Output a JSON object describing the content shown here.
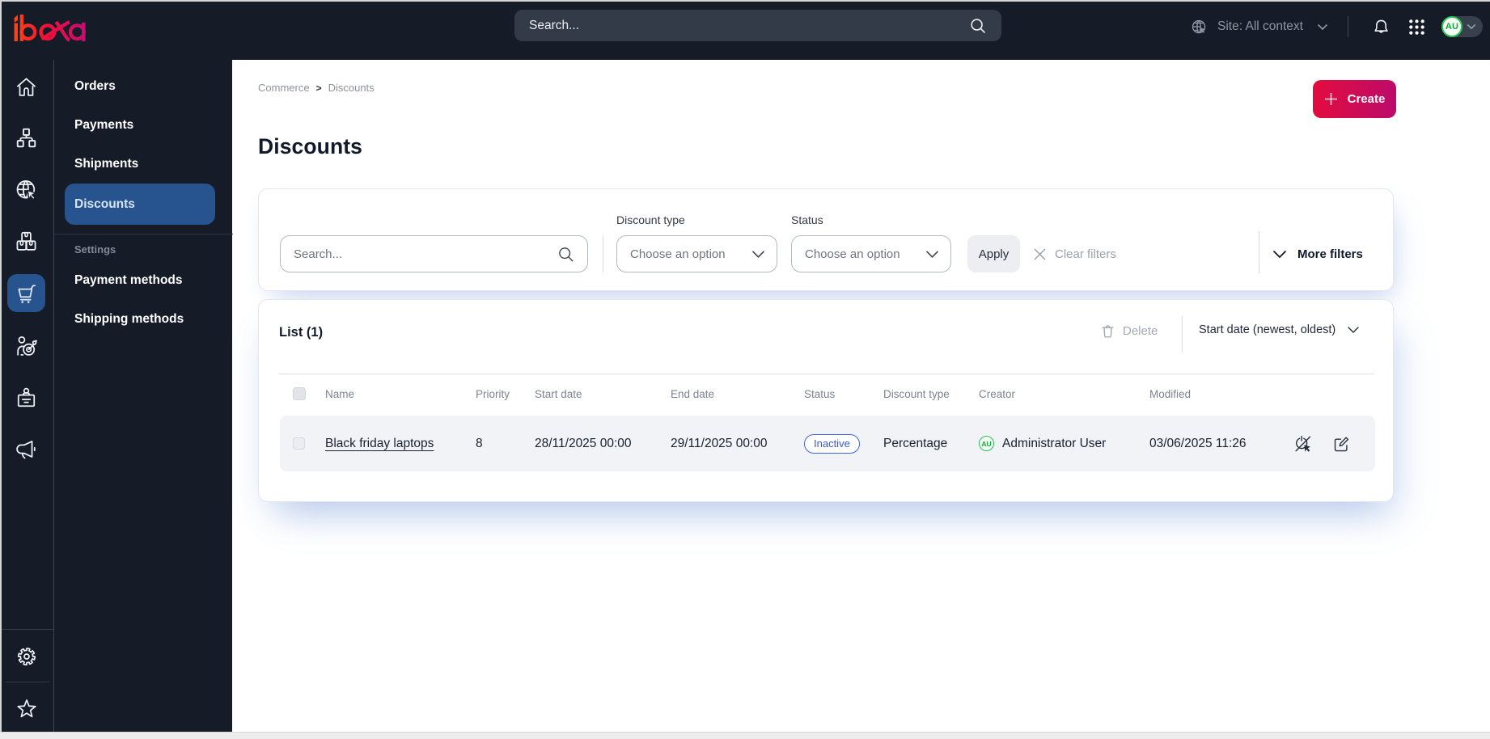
{
  "brand": "ibexa",
  "colors": {
    "topbar_bg": "#151b27",
    "active_blue": "#27548e",
    "accent_gradient_start": "#e30c3e",
    "accent_gradient_end": "#bb0b6c",
    "logo_gradient": [
      "#ff4713",
      "#ed1044",
      "#db0064"
    ],
    "avatar_green": "#2fc253",
    "badge_blue": "#4462d8",
    "row_bg": "#f2f3f7"
  },
  "topbar": {
    "search_placeholder": "Search...",
    "site_context": "Site: All context",
    "avatar_initials": "AU",
    "icons": [
      "globe-site-icon",
      "bell-icon",
      "apps-grid-icon"
    ]
  },
  "iconrail": {
    "items": [
      {
        "name": "home",
        "icon": "home-icon",
        "active": false
      },
      {
        "name": "content-structure",
        "icon": "sitemap-icon",
        "active": false
      },
      {
        "name": "site",
        "icon": "globe-cursor-icon",
        "active": false
      },
      {
        "name": "product-catalog",
        "icon": "boxes-icon",
        "active": false
      },
      {
        "name": "commerce",
        "icon": "cart-icon",
        "active": true
      },
      {
        "name": "customers",
        "icon": "person-target-icon",
        "active": false
      },
      {
        "name": "corporate",
        "icon": "badge-icon",
        "active": false
      },
      {
        "name": "marketing",
        "icon": "megaphone-icon",
        "active": false
      },
      {
        "name": "admin",
        "icon": "gear-icon",
        "active": false
      },
      {
        "name": "bookmarks",
        "icon": "star-icon",
        "active": false
      }
    ]
  },
  "sidebar": {
    "items": [
      {
        "label": "Orders",
        "active": false
      },
      {
        "label": "Payments",
        "active": false
      },
      {
        "label": "Shipments",
        "active": false
      },
      {
        "label": "Discounts",
        "active": true
      }
    ],
    "section_label": "Settings",
    "settings_items": [
      {
        "label": "Payment methods"
      },
      {
        "label": "Shipping methods"
      }
    ]
  },
  "breadcrumb": {
    "items": [
      "Commerce",
      "Discounts"
    ],
    "separator": ">"
  },
  "header": {
    "title": "Discounts",
    "create_label": "Create"
  },
  "filters": {
    "search_placeholder": "Search...",
    "discount_type": {
      "label": "Discount type",
      "value": "Choose an option"
    },
    "status": {
      "label": "Status",
      "value": "Choose an option"
    },
    "apply_label": "Apply",
    "clear_label": "Clear filters",
    "more_label": "More filters"
  },
  "list": {
    "title": "List (1)",
    "delete_label": "Delete",
    "sort_label": "Start date (newest, oldest)",
    "columns": [
      "Name",
      "Priority",
      "Start date",
      "End date",
      "Status",
      "Discount type",
      "Creator",
      "Modified"
    ],
    "rows": [
      {
        "name": "Black friday laptops",
        "priority": "8",
        "start_date": "28/11/2025 00:00",
        "end_date": "29/11/2025 00:00",
        "status": "Inactive",
        "discount_type": "Percentage",
        "creator": "Administrator User",
        "creator_initials": "AU",
        "modified": "03/06/2025 11:26",
        "actions": [
          "deactivate-icon",
          "edit-icon"
        ]
      }
    ]
  }
}
